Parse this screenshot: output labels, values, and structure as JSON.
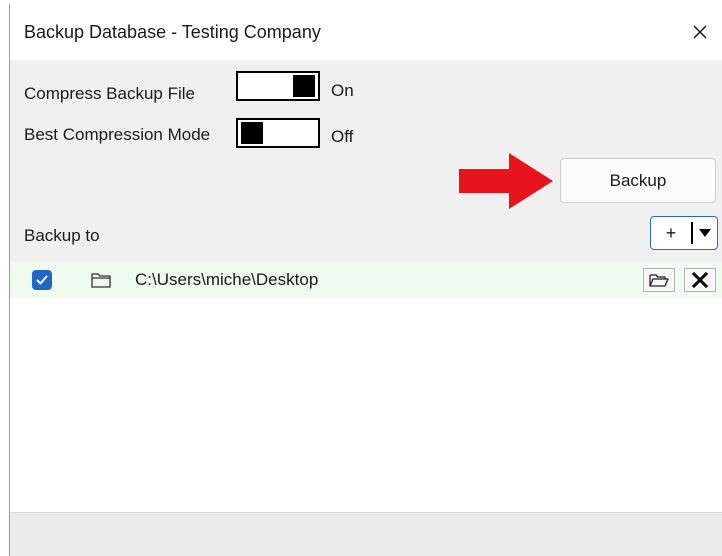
{
  "window": {
    "title": "Backup Database - Testing Company",
    "close_glyph": "✕"
  },
  "options": {
    "compress_label": "Compress Backup File",
    "compress_state": "On",
    "best_label": "Best Compression Mode",
    "best_state": "Off"
  },
  "actions": {
    "backup_label": "Backup"
  },
  "destinations": {
    "header": "Backup to",
    "add_label": "+",
    "items": [
      {
        "path": "C:\\Users\\miche\\Desktop",
        "checked": true
      }
    ]
  },
  "colors": {
    "accent": "#1e66c8",
    "arrow": "#e8141c",
    "row_highlight": "#eefbee"
  }
}
